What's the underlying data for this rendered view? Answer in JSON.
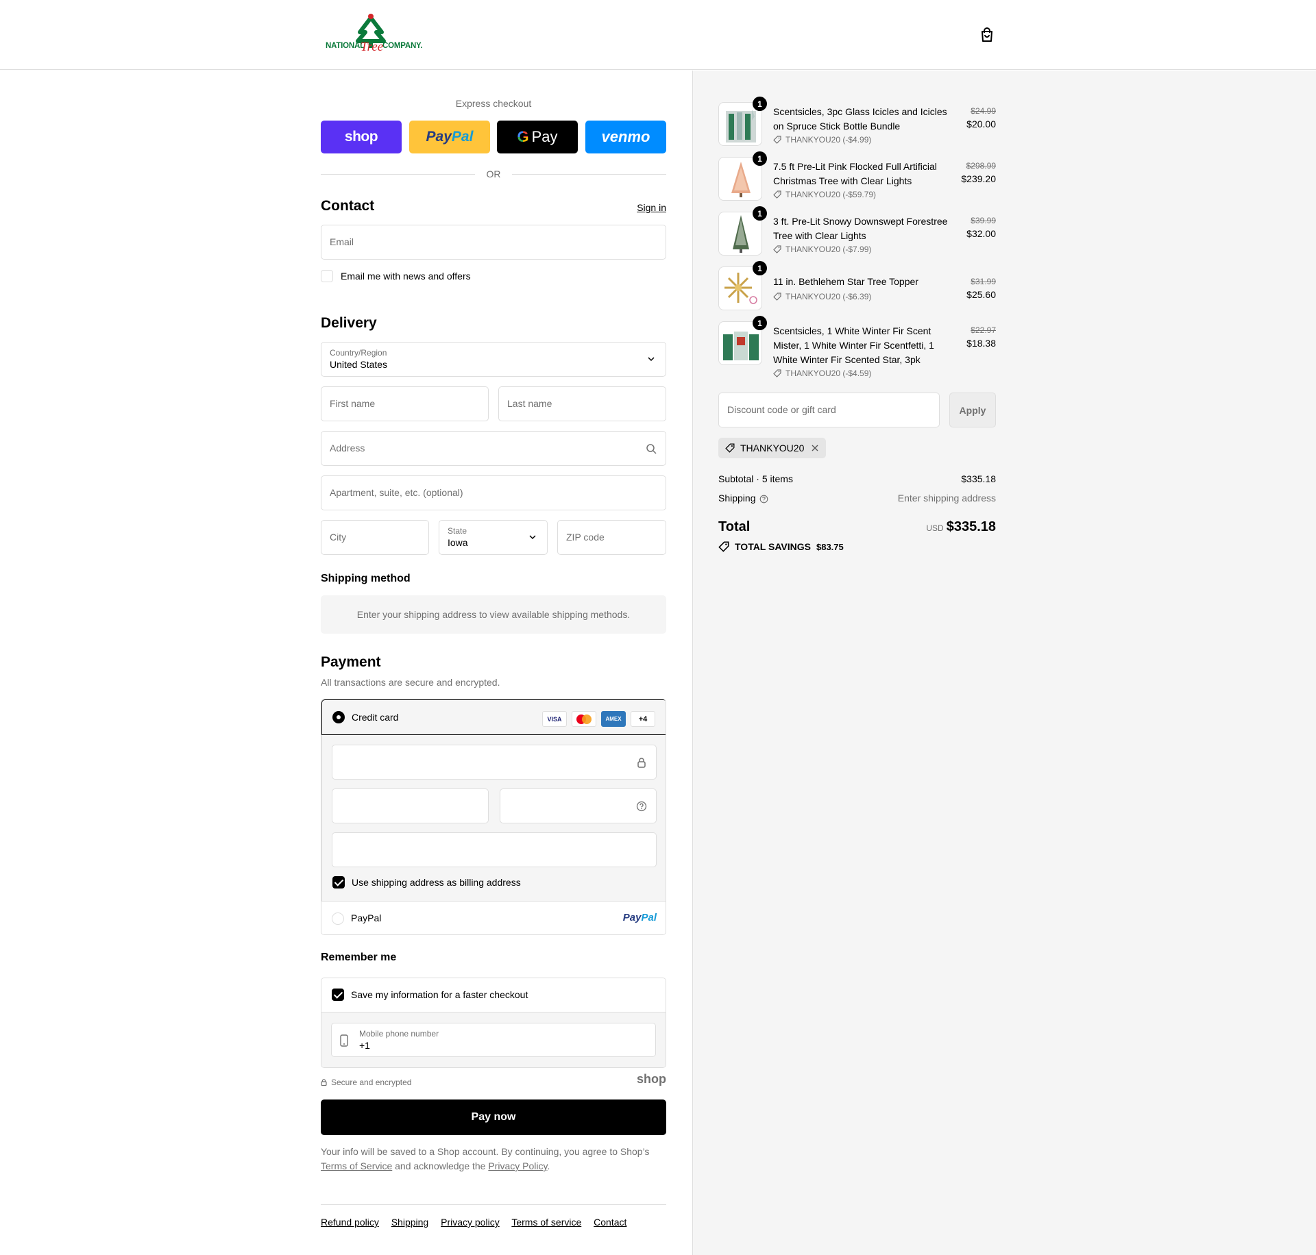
{
  "header": {
    "logo_left": "NATIONAL",
    "logo_tree": "Tree",
    "logo_right": "COMPANY."
  },
  "express": {
    "title": "Express checkout",
    "shop": "shop",
    "paypal_a": "Pay",
    "paypal_b": "Pal",
    "gpay": "Pay",
    "venmo": "venmo",
    "or": "OR"
  },
  "contact": {
    "title": "Contact",
    "sign_in": "Sign in",
    "email_placeholder": "Email",
    "newsletter_label": "Email me with news and offers"
  },
  "delivery": {
    "title": "Delivery",
    "country_label": "Country/Region",
    "country_value": "United States",
    "first_name": "First name",
    "last_name": "Last name",
    "address": "Address",
    "apartment": "Apartment, suite, etc. (optional)",
    "city": "City",
    "state_label": "State",
    "state_value": "Iowa",
    "zip": "ZIP code"
  },
  "shipping_method": {
    "title": "Shipping method",
    "info": "Enter your shipping address to view available shipping methods."
  },
  "payment": {
    "title": "Payment",
    "subtitle": "All transactions are secure and encrypted.",
    "credit_card": "Credit card",
    "visa": "VISA",
    "amex": "AMEX",
    "more_cards": "+4",
    "billing_same": "Use shipping address as billing address",
    "paypal": "PayPal",
    "paypal_logo_a": "Pay",
    "paypal_logo_b": "Pal"
  },
  "remember": {
    "title": "Remember me",
    "save_label": "Save my information for a faster checkout",
    "phone_label": "Mobile phone number",
    "phone_value": "+1",
    "secure": "Secure and encrypted",
    "shop": "shop"
  },
  "pay_now": "Pay now",
  "legal": {
    "text1": "Your info will be saved to a Shop account. By continuing, you agree to Shop’s",
    "terms": "Terms of Service",
    "text2": "and acknowledge the",
    "privacy": "Privacy Policy",
    "text3": "."
  },
  "footer": [
    "Refund policy",
    "Shipping",
    "Privacy policy",
    "Terms of service",
    "Contact"
  ],
  "cart": {
    "items": [
      {
        "qty": "1",
        "name": "Scentsicles, 3pc Glass Icicles and Icicles on Spruce Stick Bottle Bundle",
        "code": "THANKYOU20 (-$4.99)",
        "old": "$24.99",
        "price": "$20.00"
      },
      {
        "qty": "1",
        "name": "7.5 ft Pre-Lit Pink Flocked Full Artificial Christmas Tree with Clear Lights",
        "code": "THANKYOU20 (-$59.79)",
        "old": "$298.99",
        "price": "$239.20"
      },
      {
        "qty": "1",
        "name": "3 ft. Pre-Lit Snowy Downswept Forestree Tree with Clear Lights",
        "code": "THANKYOU20 (-$7.99)",
        "old": "$39.99",
        "price": "$32.00"
      },
      {
        "qty": "1",
        "name": "11 in. Bethlehem Star Tree Topper",
        "code": "THANKYOU20 (-$6.39)",
        "old": "$31.99",
        "price": "$25.60"
      },
      {
        "qty": "1",
        "name": "Scentsicles, 1 White Winter Fir Scent Mister, 1 White Winter Fir Scentfetti, 1 White Winter Fir Scented Star, 3pk",
        "code": "THANKYOU20 (-$4.59)",
        "old": "$22.97",
        "price": "$18.38"
      }
    ],
    "discount_placeholder": "Discount code or gift card",
    "apply": "Apply",
    "applied_code": "THANKYOU20",
    "subtotal_label": "Subtotal · 5 items",
    "subtotal_value": "$335.18",
    "shipping_label": "Shipping",
    "shipping_value": "Enter shipping address",
    "total_label": "Total",
    "currency": "USD",
    "total_value": "$335.18",
    "savings_label": "TOTAL SAVINGS",
    "savings_value": "$83.75"
  },
  "colors": {
    "shop_purple": "#5a31f4",
    "paypal_yellow": "#ffc43a",
    "venmo_blue": "#008cff",
    "brand_green": "#0b7a3b",
    "brand_red": "#d4262a"
  }
}
